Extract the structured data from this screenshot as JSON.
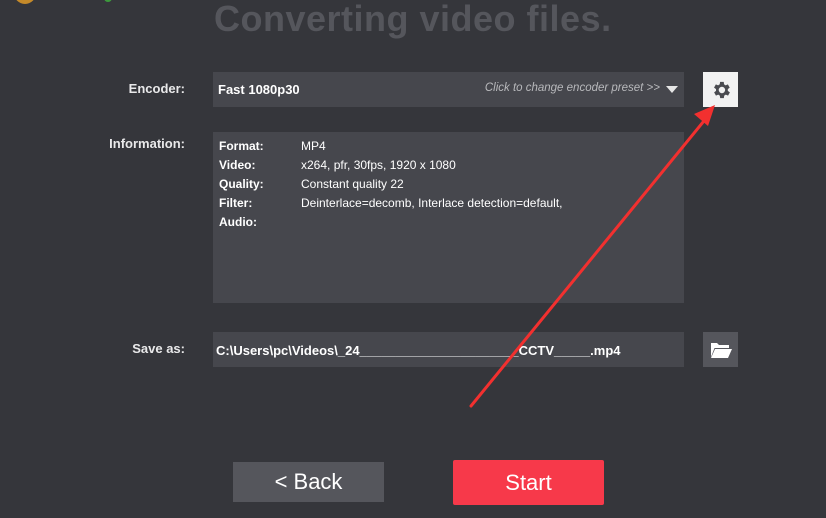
{
  "title": "Converting video files.",
  "encoder": {
    "label": "Encoder:",
    "value": "Fast 1080p30",
    "hint": "Click to change encoder preset >>",
    "settings_icon": "gear-icon",
    "dropdown_icon": "caret-down-icon"
  },
  "information": {
    "label": "Information:",
    "rows": [
      {
        "key": "Format:",
        "value": "MP4"
      },
      {
        "key": "Video:",
        "value": "x264, pfr, 30fps, 1920 x 1080"
      },
      {
        "key": "Quality:",
        "value": "Constant quality 22"
      },
      {
        "key": "Filter:",
        "value": "Deinterlace=decomb, Interlace detection=default,"
      },
      {
        "key": "Audio:",
        "value": ""
      }
    ]
  },
  "save_as": {
    "label": "Save as:",
    "value": "C:\\Users\\pc\\Videos\\_24______________________CCTV_____.mp4",
    "browse_icon": "folder-open-icon"
  },
  "buttons": {
    "back": "<  Back",
    "start": "Start"
  },
  "colors": {
    "background": "#35363b",
    "field": "#46474d",
    "start": "#f7394a",
    "annotation_arrow": "#f2302f"
  }
}
